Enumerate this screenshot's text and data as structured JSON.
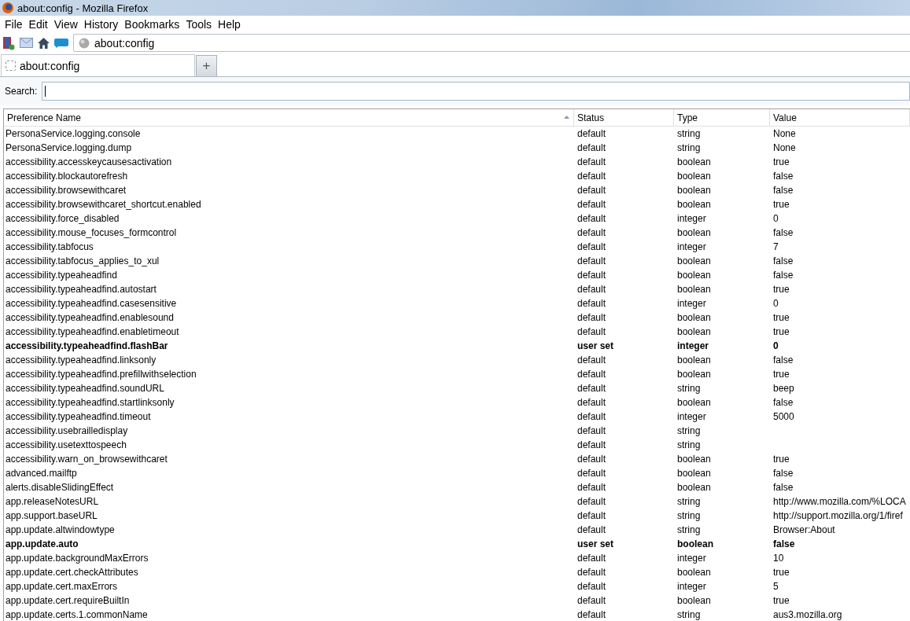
{
  "window": {
    "title": "about:config - Mozilla Firefox"
  },
  "menu": [
    "File",
    "Edit",
    "View",
    "History",
    "Bookmarks",
    "Tools",
    "Help"
  ],
  "address_bar": {
    "value": "about:config"
  },
  "tabs": [
    {
      "label": "about:config",
      "selected": true
    }
  ],
  "new_tab_button": "+",
  "search": {
    "label": "Search:"
  },
  "table": {
    "columns": [
      {
        "label": "Preference Name",
        "sorted": true
      },
      {
        "label": "Status",
        "sorted": false
      },
      {
        "label": "Type",
        "sorted": false
      },
      {
        "label": "Value",
        "sorted": false
      }
    ],
    "rows": [
      {
        "name": "PersonaService.logging.console",
        "status": "default",
        "type": "string",
        "value": "None",
        "modified": false
      },
      {
        "name": "PersonaService.logging.dump",
        "status": "default",
        "type": "string",
        "value": "None",
        "modified": false
      },
      {
        "name": "accessibility.accesskeycausesactivation",
        "status": "default",
        "type": "boolean",
        "value": "true",
        "modified": false
      },
      {
        "name": "accessibility.blockautorefresh",
        "status": "default",
        "type": "boolean",
        "value": "false",
        "modified": false
      },
      {
        "name": "accessibility.browsewithcaret",
        "status": "default",
        "type": "boolean",
        "value": "false",
        "modified": false
      },
      {
        "name": "accessibility.browsewithcaret_shortcut.enabled",
        "status": "default",
        "type": "boolean",
        "value": "true",
        "modified": false
      },
      {
        "name": "accessibility.force_disabled",
        "status": "default",
        "type": "integer",
        "value": "0",
        "modified": false
      },
      {
        "name": "accessibility.mouse_focuses_formcontrol",
        "status": "default",
        "type": "boolean",
        "value": "false",
        "modified": false
      },
      {
        "name": "accessibility.tabfocus",
        "status": "default",
        "type": "integer",
        "value": "7",
        "modified": false
      },
      {
        "name": "accessibility.tabfocus_applies_to_xul",
        "status": "default",
        "type": "boolean",
        "value": "false",
        "modified": false
      },
      {
        "name": "accessibility.typeaheadfind",
        "status": "default",
        "type": "boolean",
        "value": "false",
        "modified": false
      },
      {
        "name": "accessibility.typeaheadfind.autostart",
        "status": "default",
        "type": "boolean",
        "value": "true",
        "modified": false
      },
      {
        "name": "accessibility.typeaheadfind.casesensitive",
        "status": "default",
        "type": "integer",
        "value": "0",
        "modified": false
      },
      {
        "name": "accessibility.typeaheadfind.enablesound",
        "status": "default",
        "type": "boolean",
        "value": "true",
        "modified": false
      },
      {
        "name": "accessibility.typeaheadfind.enabletimeout",
        "status": "default",
        "type": "boolean",
        "value": "true",
        "modified": false
      },
      {
        "name": "accessibility.typeaheadfind.flashBar",
        "status": "user set",
        "type": "integer",
        "value": "0",
        "modified": true
      },
      {
        "name": "accessibility.typeaheadfind.linksonly",
        "status": "default",
        "type": "boolean",
        "value": "false",
        "modified": false
      },
      {
        "name": "accessibility.typeaheadfind.prefillwithselection",
        "status": "default",
        "type": "boolean",
        "value": "true",
        "modified": false
      },
      {
        "name": "accessibility.typeaheadfind.soundURL",
        "status": "default",
        "type": "string",
        "value": "beep",
        "modified": false
      },
      {
        "name": "accessibility.typeaheadfind.startlinksonly",
        "status": "default",
        "type": "boolean",
        "value": "false",
        "modified": false
      },
      {
        "name": "accessibility.typeaheadfind.timeout",
        "status": "default",
        "type": "integer",
        "value": "5000",
        "modified": false
      },
      {
        "name": "accessibility.usebrailledisplay",
        "status": "default",
        "type": "string",
        "modified": false
      },
      {
        "name": "accessibility.usetexttospeech",
        "status": "default",
        "type": "string",
        "modified": false
      },
      {
        "name": "accessibility.warn_on_browsewithcaret",
        "status": "default",
        "type": "boolean",
        "value": "true",
        "modified": false
      },
      {
        "name": "advanced.mailftp",
        "status": "default",
        "type": "boolean",
        "value": "false",
        "modified": false
      },
      {
        "name": "alerts.disableSlidingEffect",
        "status": "default",
        "type": "boolean",
        "value": "false",
        "modified": false
      },
      {
        "name": "app.releaseNotesURL",
        "status": "default",
        "type": "string",
        "value": "http://www.mozilla.com/%LOCA",
        "modified": false
      },
      {
        "name": "app.support.baseURL",
        "status": "default",
        "type": "string",
        "value": "http://support.mozilla.org/1/firef",
        "modified": false
      },
      {
        "name": "app.update.altwindowtype",
        "status": "default",
        "type": "string",
        "value": "Browser:About",
        "modified": false
      },
      {
        "name": "app.update.auto",
        "status": "user set",
        "type": "boolean",
        "value": "false",
        "modified": true
      },
      {
        "name": "app.update.backgroundMaxErrors",
        "status": "default",
        "type": "integer",
        "value": "10",
        "modified": false
      },
      {
        "name": "app.update.cert.checkAttributes",
        "status": "default",
        "type": "boolean",
        "value": "true",
        "modified": false
      },
      {
        "name": "app.update.cert.maxErrors",
        "status": "default",
        "type": "integer",
        "value": "5",
        "modified": false
      },
      {
        "name": "app.update.cert.requireBuiltIn",
        "status": "default",
        "type": "boolean",
        "value": "true",
        "modified": false
      },
      {
        "name": "app.update.certs.1.commonName",
        "status": "default",
        "type": "string",
        "value": "aus3.mozilla.org",
        "modified": false
      }
    ]
  }
}
